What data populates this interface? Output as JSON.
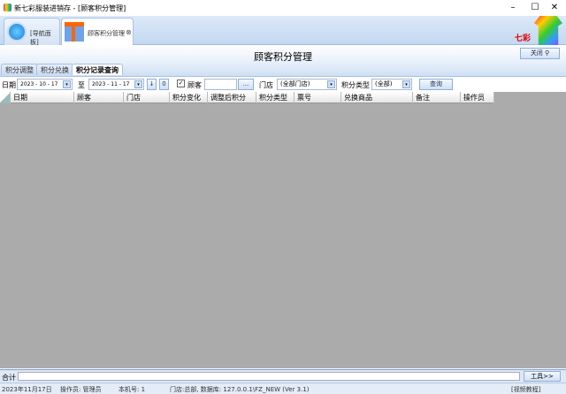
{
  "window": {
    "title": "新七彩服装进销存 - [顾客积分管理]",
    "minimize": "–",
    "maximize": "☐",
    "close": "✕"
  },
  "doc_tabs": [
    {
      "label": "[导航面板]",
      "icon": "compass-icon"
    },
    {
      "label": "顾客积分管理",
      "icon": "gift-icon",
      "active": true
    }
  ],
  "brand": {
    "logo_text": "七彩"
  },
  "header": {
    "title": "顾客积分管理",
    "close_label": "关闭"
  },
  "sub_tabs": [
    {
      "label": "积分调整"
    },
    {
      "label": "积分兑换"
    },
    {
      "label": "积分记录查询",
      "active": true
    }
  ],
  "filter": {
    "date_label": "日期",
    "date_from": "2023 - 10 - 17",
    "to_label": "至",
    "date_to": "2023 - 11 - 17",
    "btn_down": "↓",
    "btn_zero": "0",
    "customer_checked": true,
    "customer_label": "顾客",
    "customer_value": "",
    "browse_label": "...",
    "store_label": "门店",
    "store_value": "(全部门店)",
    "type_label": "积分类型",
    "type_value": "(全部)",
    "query_label": "查询"
  },
  "grid": {
    "columns": [
      "日期",
      "顾客",
      "门店",
      "积分变化",
      "调整后积分",
      "积分类型",
      "票号",
      "兑换商品",
      "备注",
      "操作员"
    ],
    "rows": []
  },
  "totals": {
    "label": "合计",
    "tools_label": "工具>>"
  },
  "status": {
    "date": "2023年11月17日",
    "operator": "操作员: 管理员",
    "machine": "本机号: 1",
    "db": "门店:总部, 数据库: 127.0.0.1\\FZ_NEW (Ver 3.1)",
    "video": "[视频教程]"
  }
}
